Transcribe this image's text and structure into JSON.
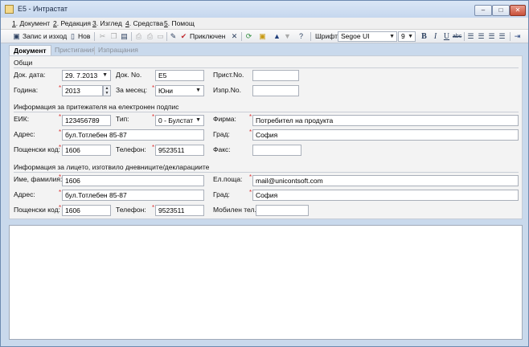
{
  "window": {
    "title": "E5 - Интрастат",
    "min": "–",
    "max": "□",
    "close": "✕"
  },
  "menu": [
    {
      "num": "1",
      "label": ". Документ"
    },
    {
      "num": "2",
      "label": ". Редакция"
    },
    {
      "num": "3",
      "label": ". Изглед"
    },
    {
      "num": "4",
      "label": ". Средства"
    },
    {
      "num": "5",
      "label": ". Помощ"
    }
  ],
  "toolbar": {
    "save_label": "Запис и изход",
    "new_label": "Нов",
    "complete_label": "Приключен",
    "font_label": "Шрифт:",
    "font_value": "Segoe UI",
    "size_value": "9",
    "icons": [
      "save-icon",
      "new-icon",
      "cut-icon",
      "copy-icon",
      "paste-icon",
      "print-icon",
      "print-preview-icon",
      "export-icon",
      "edit-icon",
      "check-icon",
      "cancel-icon",
      "refresh-icon",
      "attach-icon",
      "arrow-up-icon",
      "arrow-down-icon",
      "help-icon",
      "bold-icon",
      "italic-icon",
      "underline-icon",
      "strikethrough-icon",
      "align-left-icon",
      "align-center-icon",
      "align-right-icon",
      "justify-icon",
      "indent-icon"
    ]
  },
  "tabs": [
    "Документ",
    "Пристигания",
    "Изпращания"
  ],
  "general": {
    "title": "Общи",
    "doc_date_label": "Док. дата:",
    "doc_date_value": "29. 7.2013",
    "doc_no_label": "Док. No.",
    "doc_no_value": "E5",
    "arrival_no_label": "Приcт.No.",
    "arrival_no_value": "",
    "year_label": "Година:",
    "year_value": "2013",
    "month_label": "За месец:",
    "month_value": "Юни",
    "dispatch_no_label": "Изпр.No.",
    "dispatch_no_value": ""
  },
  "signature_owner": {
    "title": "Информация за притежателя на електронен подпис",
    "eik_label": "ЕИК:",
    "eik_value": "123456789",
    "type_label": "Тип:",
    "type_value": "0 - Булстат",
    "company_label": "Фирма:",
    "company_value": "Потребител на продукта",
    "address_label": "Адрес:",
    "address_value": "бул.Тотлебен 85-87",
    "city_label": "Град:",
    "city_value": "София",
    "postcode_label": "Пощенски код:",
    "postcode_value": "1606",
    "phone_label": "Телефон:",
    "phone_value": "9523511",
    "fax_label": "Факс:",
    "fax_value": ""
  },
  "preparer": {
    "title": "Информация за лицето, изготвило дневниците/декларациите",
    "name_label": "Име, фамилия:",
    "name_value": "1606",
    "email_label": "Ел.поща:",
    "email_value": "mail@unicontsoft.com",
    "address_label": "Адрес:",
    "address_value": "бул.Тотлебен 85-87",
    "city_label": "Град:",
    "city_value": "София",
    "postcode_label": "Пощенски код:",
    "postcode_value": "1606",
    "phone_label": "Телефон:",
    "phone_value": "9523511",
    "mobile_label": "Мобилен тел.",
    "mobile_value": ""
  },
  "required_mark": "*"
}
